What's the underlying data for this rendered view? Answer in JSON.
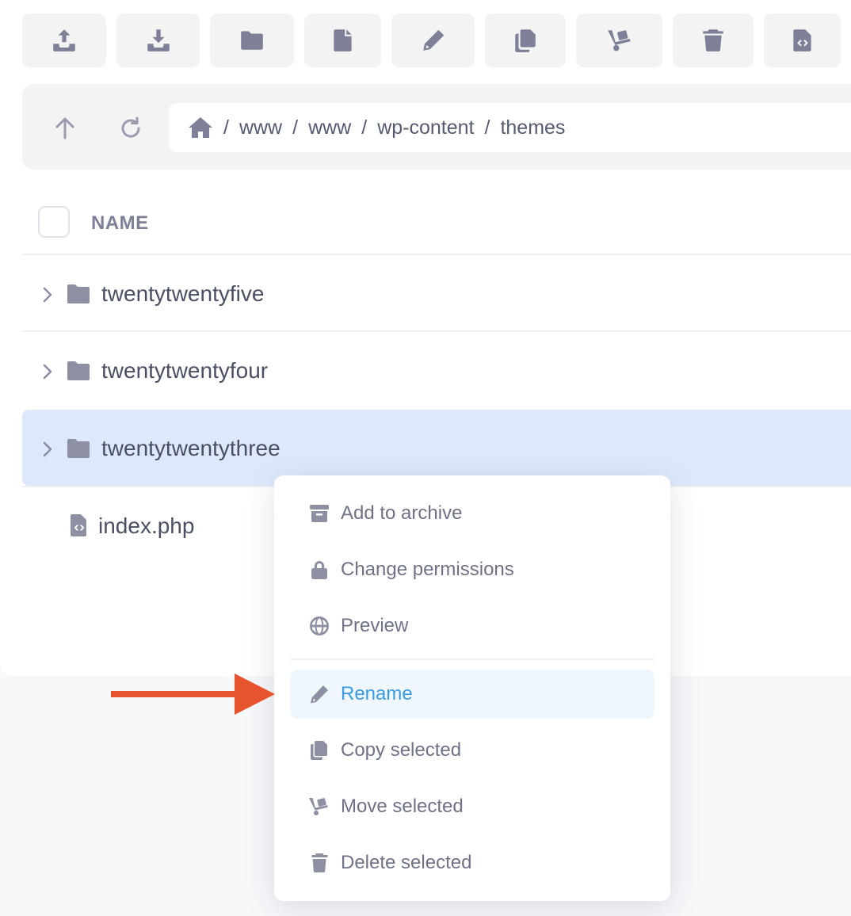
{
  "toolbar": {
    "buttons": [
      {
        "name": "upload",
        "icon": "upload-icon"
      },
      {
        "name": "download",
        "icon": "download-icon"
      },
      {
        "name": "new-folder",
        "icon": "folder-icon"
      },
      {
        "name": "new-file",
        "icon": "file-icon"
      },
      {
        "name": "rename",
        "icon": "pencil-icon"
      },
      {
        "name": "copy",
        "icon": "copy-icon"
      },
      {
        "name": "move",
        "icon": "dolly-icon"
      },
      {
        "name": "delete",
        "icon": "trash-icon"
      },
      {
        "name": "code-file",
        "icon": "code-file-icon"
      }
    ]
  },
  "breadcrumb": {
    "home_icon": "home-icon",
    "separator": "/",
    "parts": [
      "www",
      "www",
      "wp-content",
      "themes"
    ]
  },
  "table": {
    "column_name": "NAME",
    "rows": [
      {
        "type": "folder",
        "name": "twentytwentyfive",
        "selected": false
      },
      {
        "type": "folder",
        "name": "twentytwentyfour",
        "selected": false
      },
      {
        "type": "folder",
        "name": "twentytwentythree",
        "selected": true
      },
      {
        "type": "file",
        "name": "index.php",
        "selected": false
      }
    ]
  },
  "context_menu": {
    "items": [
      {
        "label": "Add to archive",
        "icon": "archive-icon"
      },
      {
        "label": "Change permissions",
        "icon": "lock-icon"
      },
      {
        "label": "Preview",
        "icon": "globe-icon"
      },
      {
        "label": "Rename",
        "icon": "pencil-icon",
        "active": true
      },
      {
        "label": "Copy selected",
        "icon": "copy-icon"
      },
      {
        "label": "Move selected",
        "icon": "dolly-icon"
      },
      {
        "label": "Delete selected",
        "icon": "trash-icon"
      }
    ]
  },
  "colors": {
    "accent": "#3a9be0",
    "selected_row": "#dde9fb",
    "annotation_arrow": "#e8532f"
  }
}
